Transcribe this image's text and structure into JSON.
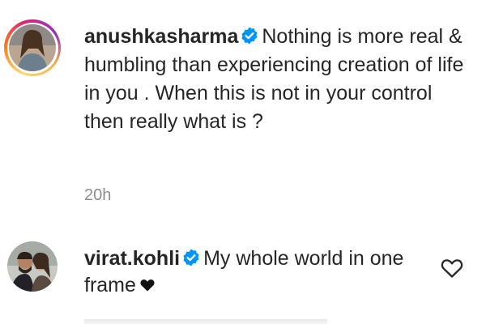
{
  "post": {
    "username": "anushkasharma",
    "caption": "Nothing is more real & humbling than experiencing creation of life in you . When this is not in your control then really what is ?",
    "timestamp": "20h"
  },
  "comment": {
    "username": "virat.kohli",
    "text": "My whole world in one frame"
  },
  "colors": {
    "verified_badge": "#0095f6",
    "text_primary": "#262626",
    "text_secondary": "#8e8e8e",
    "story_ring": [
      "#feda75",
      "#fa7e1e",
      "#d62976",
      "#962fbf"
    ]
  },
  "icons": {
    "verified": "verified-badge-icon",
    "like": "heart-outline-icon",
    "inline_heart": "black-heart-emoji"
  }
}
